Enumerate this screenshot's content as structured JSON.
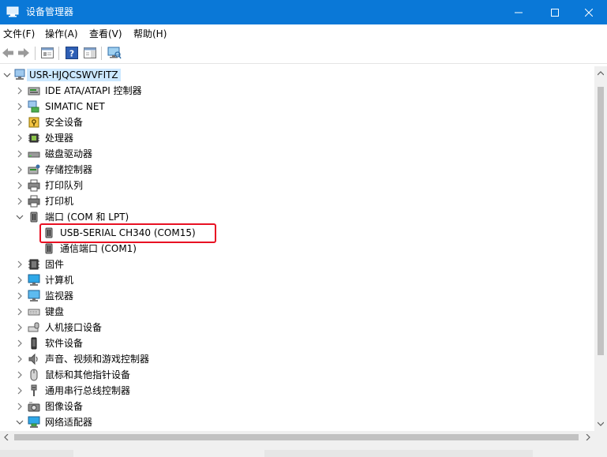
{
  "window": {
    "title": "设备管理器",
    "app_icon": "device-manager-icon",
    "accent": "#0a78d7"
  },
  "menu": [
    {
      "label": "文件(F)",
      "name": "menu-file"
    },
    {
      "label": "操作(A)",
      "name": "menu-action"
    },
    {
      "label": "查看(V)",
      "name": "menu-view"
    },
    {
      "label": "帮助(H)",
      "name": "menu-help"
    }
  ],
  "toolbar": [
    "back-icon",
    "forward-icon",
    "properties-icon",
    "help-icon",
    "action-pane-icon",
    "scan-hardware-icon"
  ],
  "tree": {
    "root": {
      "label": "USR-HJQCSWVFITZ",
      "icon": "computer-icon",
      "expanded": true,
      "selected": true
    },
    "items": [
      {
        "label": "IDE ATA/ATAPI 控制器",
        "icon": "ide-controller-icon",
        "level": 1,
        "expander": "collapsed"
      },
      {
        "label": "SIMATIC NET",
        "icon": "network-device-icon",
        "level": 1,
        "expander": "collapsed"
      },
      {
        "label": "安全设备",
        "icon": "security-device-icon",
        "level": 1,
        "expander": "collapsed"
      },
      {
        "label": "处理器",
        "icon": "processor-icon",
        "level": 1,
        "expander": "collapsed"
      },
      {
        "label": "磁盘驱动器",
        "icon": "disk-drive-icon",
        "level": 1,
        "expander": "collapsed"
      },
      {
        "label": "存储控制器",
        "icon": "storage-controller-icon",
        "level": 1,
        "expander": "collapsed"
      },
      {
        "label": "打印队列",
        "icon": "print-queue-icon",
        "level": 1,
        "expander": "collapsed"
      },
      {
        "label": "打印机",
        "icon": "printer-icon",
        "level": 1,
        "expander": "collapsed"
      },
      {
        "label": "端口 (COM 和 LPT)",
        "icon": "port-icon",
        "level": 1,
        "expander": "expanded"
      },
      {
        "label": "USB-SERIAL CH340 (COM15)",
        "icon": "port-icon",
        "level": 2,
        "expander": "none",
        "highlighted": true
      },
      {
        "label": "通信端口 (COM1)",
        "icon": "port-icon",
        "level": 2,
        "expander": "none"
      },
      {
        "label": "固件",
        "icon": "firmware-icon",
        "level": 1,
        "expander": "collapsed"
      },
      {
        "label": "计算机",
        "icon": "computer-monitor-icon",
        "level": 1,
        "expander": "collapsed"
      },
      {
        "label": "监视器",
        "icon": "monitor-icon",
        "level": 1,
        "expander": "collapsed"
      },
      {
        "label": "键盘",
        "icon": "keyboard-icon",
        "level": 1,
        "expander": "collapsed"
      },
      {
        "label": "人机接口设备",
        "icon": "hid-icon",
        "level": 1,
        "expander": "collapsed"
      },
      {
        "label": "软件设备",
        "icon": "software-device-icon",
        "level": 1,
        "expander": "collapsed"
      },
      {
        "label": "声音、视频和游戏控制器",
        "icon": "sound-icon",
        "level": 1,
        "expander": "collapsed"
      },
      {
        "label": "鼠标和其他指针设备",
        "icon": "mouse-icon",
        "level": 1,
        "expander": "collapsed"
      },
      {
        "label": "通用串行总线控制器",
        "icon": "usb-controller-icon",
        "level": 1,
        "expander": "collapsed"
      },
      {
        "label": "图像设备",
        "icon": "imaging-device-icon",
        "level": 1,
        "expander": "collapsed"
      },
      {
        "label": "网络适配器",
        "icon": "network-adapter-icon",
        "level": 1,
        "expander": "expanded"
      }
    ]
  },
  "colors": {
    "selection": "#cce8ff",
    "highlight_box": "#e81123"
  }
}
